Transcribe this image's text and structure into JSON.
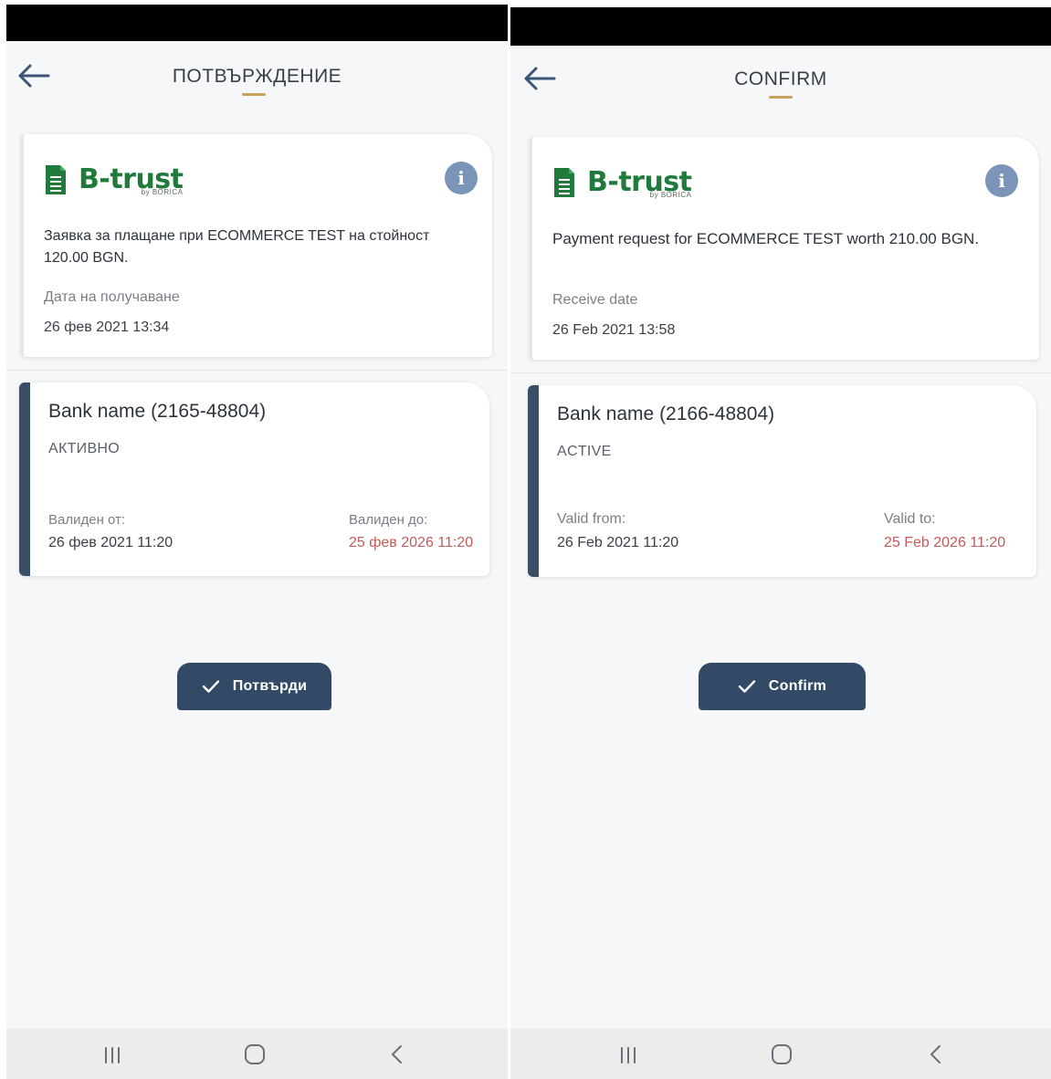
{
  "left": {
    "title": "ПОТВЪРЖДЕНИЕ",
    "brand": {
      "name": "B-trust",
      "sub": "by BORICA"
    },
    "info_icon": "i",
    "request": {
      "text": "Заявка за плащане при ECOMMERCE TEST на стойност 120.00 BGN.",
      "date_label": "Дата на получаване",
      "date_value": "26 фев 2021 13:34"
    },
    "bank": {
      "name": "Bank name (2165-48804)",
      "status": "АКТИВНО",
      "valid_from_label": "Валиден от:",
      "valid_from": "26 фев 2021 11:20",
      "valid_to_label": "Валиден до:",
      "valid_to": "25 фев 2026 11:20"
    },
    "confirm_label": "Потвърди"
  },
  "right": {
    "title": "CONFIRM",
    "brand": {
      "name": "B-trust",
      "sub": "by BORICA"
    },
    "info_icon": "i",
    "request": {
      "text": "Payment request for ECOMMERCE TEST worth 210.00 BGN.",
      "date_label": "Receive date",
      "date_value": "26 Feb 2021 13:58"
    },
    "bank": {
      "name": "Bank name (2166-48804)",
      "status": "ACTIVE",
      "valid_from_label": "Valid from:",
      "valid_from": "26 Feb 2021 11:20",
      "valid_to_label": "Valid to:",
      "valid_to": "25 Feb 2026 11:20"
    },
    "confirm_label": "Confirm"
  },
  "icons": [
    "back-arrow-icon",
    "info-icon",
    "check-icon",
    "recent-apps-icon",
    "home-icon",
    "nav-back-icon"
  ],
  "colors": {
    "accent": "#c8a25a",
    "primary": "#334a66",
    "brand_green": "#1f7a3b",
    "info_blue": "#7a95b8",
    "expiry_red": "#c45a5a"
  }
}
